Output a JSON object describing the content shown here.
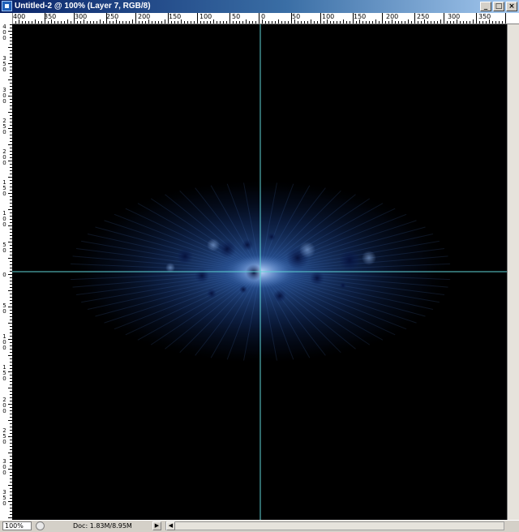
{
  "window": {
    "title": "Untitled-2 @ 100% (Layer 7, RGB/8)",
    "minimize_glyph": "_",
    "maximize_glyph": "□",
    "close_glyph": "×"
  },
  "ruler_top": {
    "labels": [
      "400",
      "350",
      "300",
      "250",
      "200",
      "150",
      "100",
      "50",
      "0",
      "50",
      "100",
      "150",
      "200",
      "250",
      "300",
      "350"
    ]
  },
  "ruler_left": {
    "labels": [
      "400",
      "350",
      "300",
      "250",
      "200",
      "150",
      "100",
      "50",
      "0",
      "50",
      "100",
      "150",
      "200",
      "250",
      "300",
      "350"
    ]
  },
  "statusbar": {
    "zoom": "100%",
    "doc_info": "Doc: 1.83M/8.95M",
    "arrow_right": "▶",
    "arrow_left": "◀"
  },
  "icons": {
    "app": "photoshop-icon",
    "zoom": "navigator-icon"
  },
  "colors": {
    "guide": "#5fd3d6",
    "canvas": "#000000",
    "glow": "#3f74c4"
  }
}
